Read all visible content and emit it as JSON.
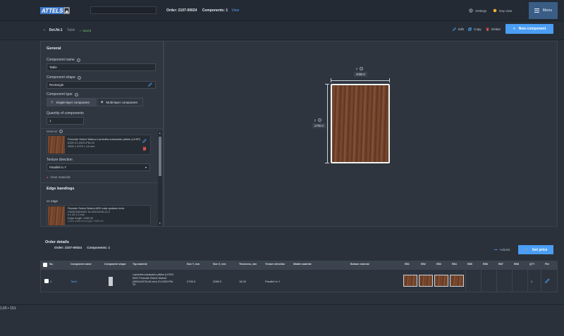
{
  "topbar": {
    "logo_text": "ATTELS",
    "order_label": "Order: 2107-00024",
    "components_label": "Components: 1",
    "view_link": "View",
    "settings_label": "Settings",
    "dayview_label": "Day view",
    "menu_label": "Menu"
  },
  "subbar": {
    "back_label": "Det.Nr.1",
    "item_name": "Table",
    "saved_label": "Saved",
    "edit_label": "Edit",
    "copy_label": "Copy",
    "delete_label": "Delete",
    "new_component_label": "New component"
  },
  "general": {
    "title": "General",
    "component_name_label": "Component name",
    "component_name_value": "Table",
    "component_shape_label": "Component shape",
    "component_shape_value": "Rectangle",
    "component_type_label": "Component type",
    "type_single": "Single-layer component",
    "type_multi": "Multi-layer component",
    "quantity_label": "Quantity of components",
    "quantity_value": "1",
    "material_label": "Material",
    "material_name": "Fineside Select Walnut Laminēta kokskaidu plātne (LKSP)",
    "material_code": "6320 01-0320-PM-10",
    "material_size": "2800 x 2070 x 18 mm",
    "texture_label": "Texture direction",
    "texture_value": "Parallel to Y",
    "clear_materials": "Clear materials"
  },
  "edge_bandings": {
    "title": "Edge bandings",
    "edge_label": "x1 edge",
    "edge_name": "Fineside Select Walnut ABS mala apdares lente",
    "edge_code": "H3203106/6320 16-H3203106-22-2",
    "edge_size": "0 x 22 x 2 mm",
    "edge_length": "Edge length: 2080.00",
    "edge_used": "Used material length: 2580.00"
  },
  "preview": {
    "x_label": "x",
    "x_value": "2080.0",
    "y_label": "y",
    "y_value": "2700.0"
  },
  "order_details": {
    "title": "Order details",
    "order_label": "Order: 2107-00024",
    "components_label": "Components: 1",
    "actions_label": "Actions",
    "get_price_label": "Get price"
  },
  "table": {
    "headers": [
      "No.",
      "Component name",
      "Component shape",
      "Top material",
      "Size Y, mm",
      "Size X, mm",
      "Thickness, mm",
      "Texture direction",
      "Middle material",
      "Bottom material",
      "EB1",
      "EB2",
      "EB3",
      "EB4",
      "EB5",
      "EB6",
      "EB7",
      "EB8",
      "QTY",
      "File"
    ],
    "row": {
      "no": "1",
      "name": "Table",
      "top_material_1": "Laminēta kokskaidu plātne (LKSP)",
      "top_material_2": "6320 Fineside Select Walnut",
      "top_material_3": "(2800x2070x18 mm) 01-0320-PM-",
      "top_material_4": "10",
      "size_y": "2700.0",
      "size_x": "2080.0",
      "thickness": "18.00",
      "texture": "Parallel to Y",
      "qty": "1"
    }
  },
  "status": {
    "coordinates": "1,65 • 151"
  },
  "colors": {
    "accent": "#4b9ef4",
    "background": "#2a313b",
    "panel": "#2f3640",
    "menu": "#3a5d86"
  }
}
